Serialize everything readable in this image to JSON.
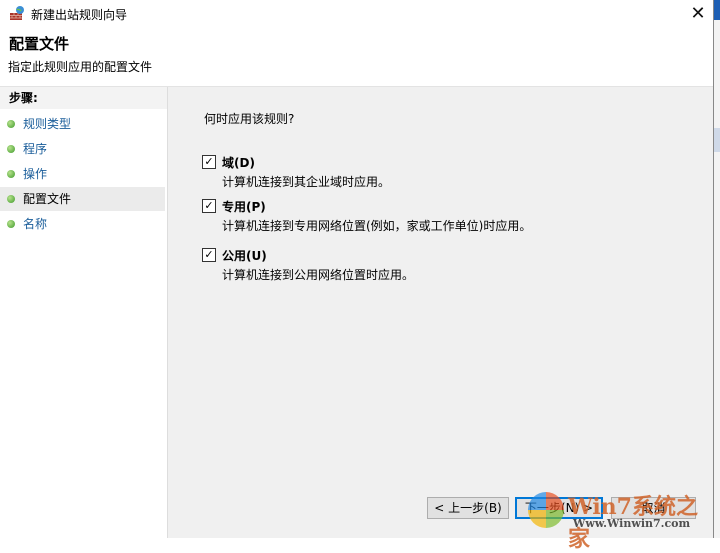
{
  "window": {
    "title": "新建出站规则向导",
    "close_glyph": "✕"
  },
  "header": {
    "title": "配置文件",
    "subtitle": "指定此规则应用的配置文件"
  },
  "steps": {
    "heading": "步骤:",
    "items": [
      {
        "label": "规则类型"
      },
      {
        "label": "程序"
      },
      {
        "label": "操作"
      },
      {
        "label": "配置文件",
        "current": true
      },
      {
        "label": "名称"
      }
    ]
  },
  "main": {
    "question": "何时应用该规则?",
    "options": [
      {
        "label": "域(D)",
        "desc": "计算机连接到其企业域时应用。",
        "checked": true
      },
      {
        "label": "专用(P)",
        "desc": "计算机连接到专用网络位置(例如，家或工作单位)时应用。",
        "checked": true
      },
      {
        "label": "公用(U)",
        "desc": "计算机连接到公用网络位置时应用。",
        "checked": true
      }
    ]
  },
  "buttons": {
    "back": "< 上一步(B)",
    "next": "下一步(N) >",
    "cancel": "取消"
  },
  "watermark": {
    "brand": "Win7系统之家",
    "url": "Www.Winwin7.com"
  }
}
